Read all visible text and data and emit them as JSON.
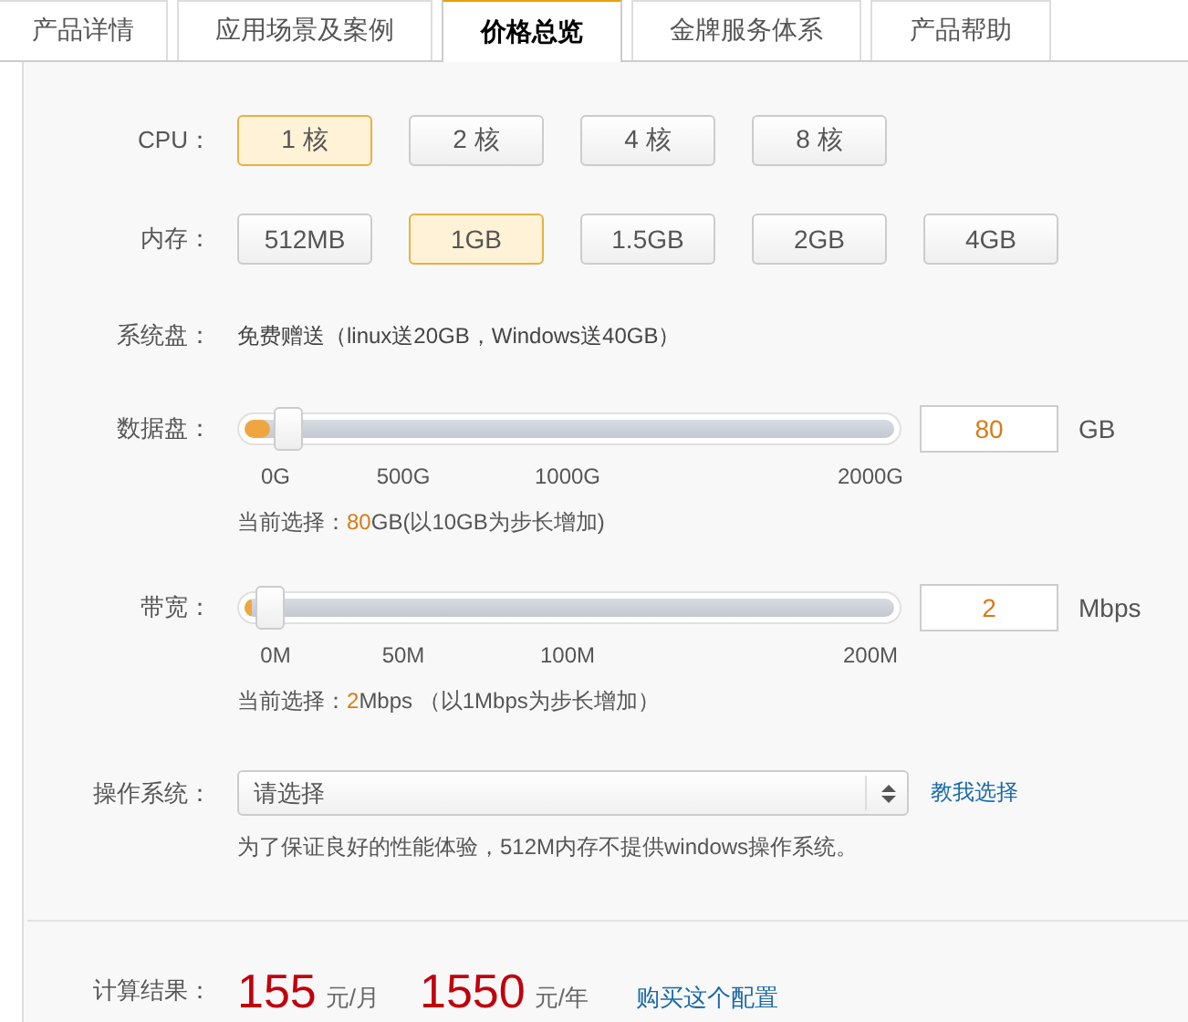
{
  "tabs": [
    {
      "label": "产品详情",
      "selected": false
    },
    {
      "label": "应用场景及案例",
      "selected": false
    },
    {
      "label": "价格总览",
      "selected": true
    },
    {
      "label": "金牌服务体系",
      "selected": false
    },
    {
      "label": "产品帮助",
      "selected": false
    }
  ],
  "cpu": {
    "label": "CPU：",
    "options": [
      {
        "label": "1 核",
        "selected": true
      },
      {
        "label": "2 核",
        "selected": false
      },
      {
        "label": "4 核",
        "selected": false
      },
      {
        "label": "8 核",
        "selected": false
      }
    ]
  },
  "memory": {
    "label": "内存：",
    "options": [
      {
        "label": "512MB",
        "selected": false
      },
      {
        "label": "1GB",
        "selected": true
      },
      {
        "label": "1.5GB",
        "selected": false
      },
      {
        "label": "2GB",
        "selected": false
      },
      {
        "label": "4GB",
        "selected": false
      }
    ]
  },
  "system_disk": {
    "label": "系统盘：",
    "value": "免费赠送（linux送20GB，Windows送40GB）"
  },
  "data_disk": {
    "label": "数据盘：",
    "level": 0.04,
    "value": "80",
    "unit": "GB",
    "ticks": [
      "0G",
      "500G",
      "1000G",
      "2000G"
    ],
    "note": {
      "prefix": "当前选择：",
      "value": "80",
      "suffix": "GB(以10GB为步长增加)"
    }
  },
  "bandwidth": {
    "label": "带宽：",
    "level": 0.01,
    "value": "2",
    "unit": "Mbps",
    "ticks": [
      "0M",
      "50M",
      "100M",
      "200M"
    ],
    "note": {
      "prefix": "当前选择：",
      "value": "2",
      "suffix": "Mbps （以1Mbps为步长增加）"
    }
  },
  "os": {
    "label": "操作系统：",
    "placeholder": "请选择",
    "link": "教我选择",
    "hint": "为了保证良好的性能体验，512M内存不提供windows操作系统。"
  },
  "result": {
    "label": "计算结果：",
    "monthly": "155",
    "monthly_unit": "元/月",
    "yearly": "1550",
    "yearly_unit": "元/年",
    "buy_link": "购买这个配置"
  }
}
